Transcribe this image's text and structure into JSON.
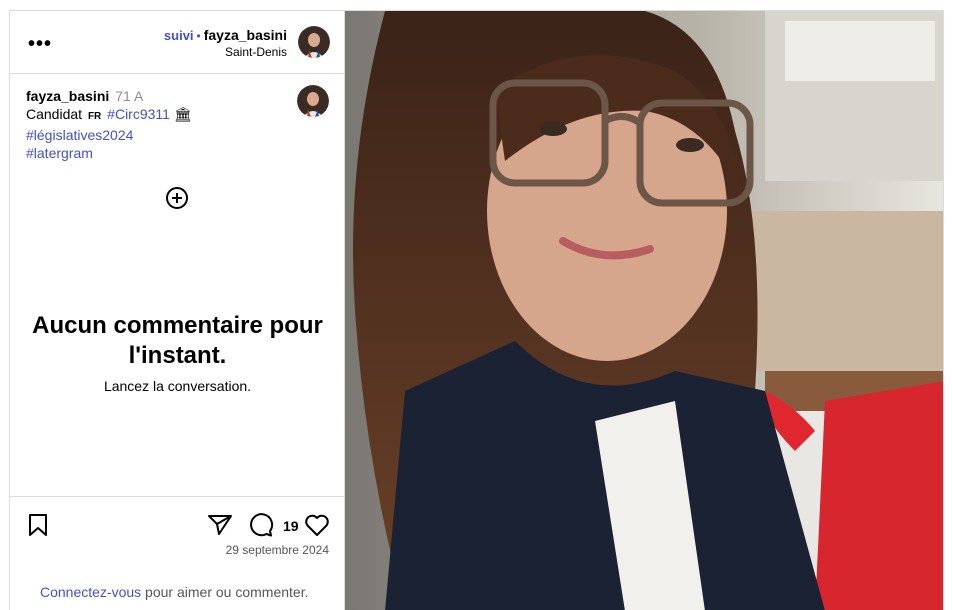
{
  "header": {
    "follow_label": "suivi",
    "separator": "•",
    "username": "fayza_basini",
    "location": "Saint-Denis",
    "more_icon": "more-horizontal-icon"
  },
  "caption": {
    "username": "fayza_basini",
    "age": "71 A",
    "text_before": "Candidat",
    "flag": "FR",
    "hashtags": [
      "#Circ9311",
      "#législatives2024",
      "#latergram"
    ],
    "building_icon": "🏛"
  },
  "comments": {
    "empty_title": "Aucun commentaire pour l'instant.",
    "empty_subtitle": "Lancez la conversation.",
    "add_icon": "plus-circle-icon"
  },
  "actions": {
    "like_count": "19",
    "date": "29 septembre 2024"
  },
  "footer": {
    "login_link": "Connectez-vous",
    "login_text": " pour aimer ou commenter."
  },
  "colors": {
    "link": "#4150cc",
    "border": "#dbdbdb"
  }
}
